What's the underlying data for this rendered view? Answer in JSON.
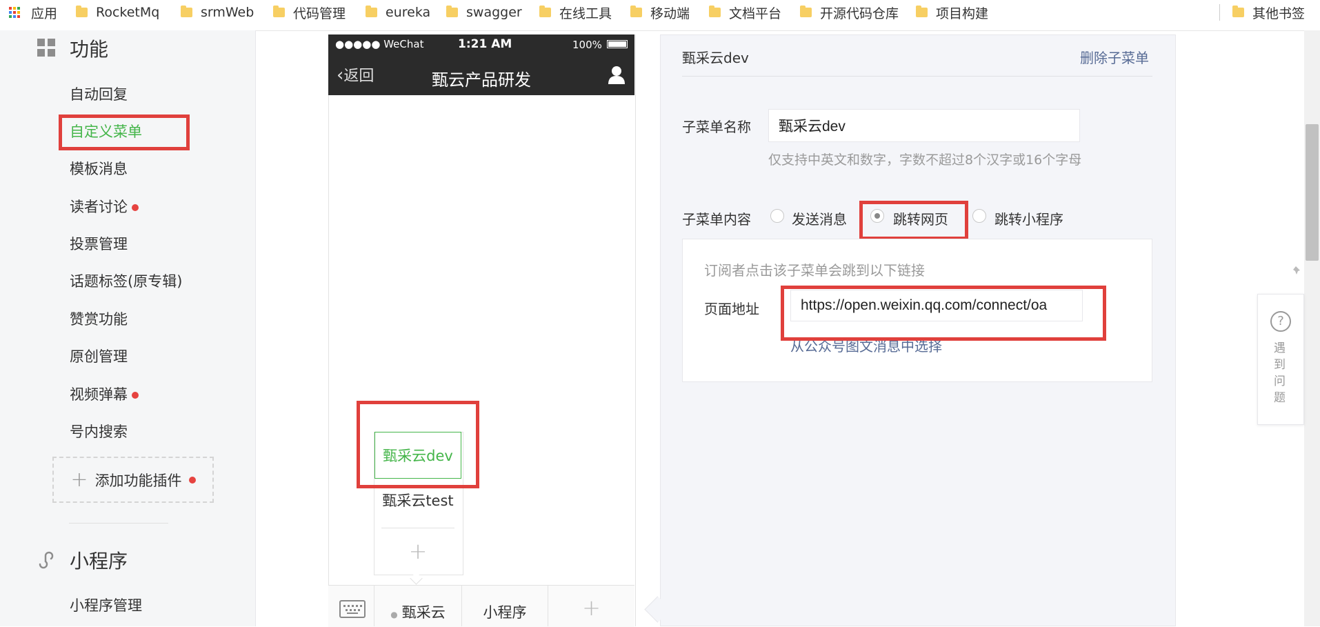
{
  "bookmarks": {
    "apps_label": "应用",
    "items": [
      "RocketMq",
      "srmWeb",
      "代码管理",
      "eureka",
      "swagger",
      "在线工具",
      "移动端",
      "文档平台",
      "开源代码仓库",
      "项目构建"
    ],
    "other": "其他书签"
  },
  "sidebar": {
    "section1_title": "功能",
    "items": [
      "自动回复",
      "自定义菜单",
      "模板消息",
      "读者讨论",
      "投票管理",
      "话题标签(原专辑)",
      "赞赏功能",
      "原创管理",
      "视频弹幕",
      "号内搜索"
    ],
    "add_plugin": "添加功能插件",
    "section2_title": "小程序",
    "mini_item": "小程序管理"
  },
  "phone": {
    "carrier": "●●●●● WeChat",
    "time": "1:21 AM",
    "battery": "100%",
    "back": "返回",
    "title": "甄云产品研发",
    "submenu": [
      "甄采云dev",
      "甄采云test"
    ],
    "bottom_menu": [
      "甄采云",
      "小程序"
    ]
  },
  "editor": {
    "header_name": "甄采云dev",
    "delete_label": "删除子菜单",
    "name_label": "子菜单名称",
    "name_value": "甄采云dev",
    "name_hint": "仅支持中英文和数字，字数不超过8个汉字或16个字母",
    "content_label": "子菜单内容",
    "options": [
      "发送消息",
      "跳转网页",
      "跳转小程序"
    ],
    "selected_option": "跳转网页",
    "link_desc": "订阅者点击该子菜单会跳到以下链接",
    "url_label": "页面地址",
    "url_value": "https://open.weixin.qq.com/connect/oa",
    "choose_link": "从公众号图文消息中选择"
  },
  "help": {
    "text": "遇到问题"
  },
  "colors": {
    "accent_green": "#44b549",
    "highlight_red": "#e0403c",
    "link_blue": "#576b95"
  }
}
